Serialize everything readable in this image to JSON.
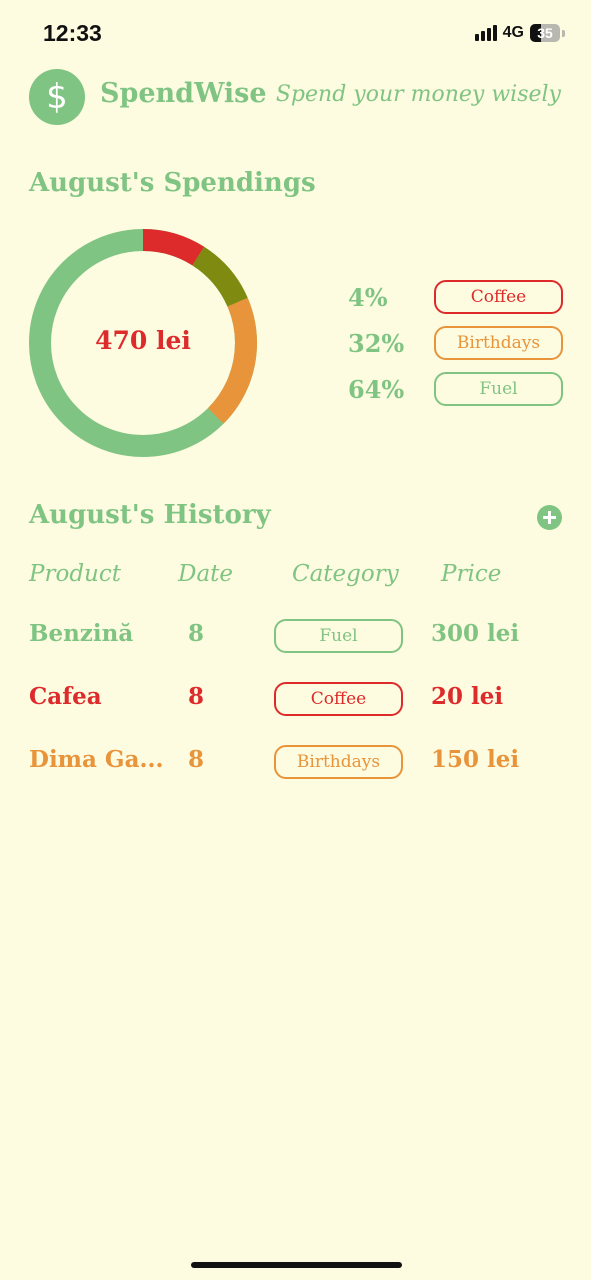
{
  "status_bar": {
    "time": "12:33",
    "network": "4G",
    "battery": "35",
    "battery_level": 0.35
  },
  "header": {
    "logo_icon": "dollar-sign-icon",
    "logo_glyph": "$",
    "app_name": "SpendWise",
    "tagline": "Spend your money wisely"
  },
  "spendings": {
    "title": "August's Spendings",
    "total": "470 lei",
    "chart_data": {
      "type": "pie",
      "title": "",
      "slices": [
        {
          "label": "Coffee",
          "percent": 4,
          "color": "#dd2b2b"
        },
        {
          "label": "Birthdays",
          "percent": 32,
          "color": "#e8943a"
        },
        {
          "label": "Fuel",
          "percent": 64,
          "color": "#7fc482"
        }
      ],
      "note_colors_in_ring": [
        "#dd2b2b",
        "#7f8a10",
        "#e8943a",
        "#7fc482"
      ]
    },
    "legend": [
      {
        "percent": "4%",
        "category": "Coffee",
        "style": "red"
      },
      {
        "percent": "32%",
        "category": "Birthdays",
        "style": "orange"
      },
      {
        "percent": "64%",
        "category": "Fuel",
        "style": "green"
      }
    ]
  },
  "history": {
    "title": "August's History",
    "add_icon": "plus-circle-icon",
    "columns": [
      "Product",
      "Date",
      "Category",
      "Price"
    ],
    "rows": [
      {
        "product": "Benzină",
        "date": "8",
        "category": "Fuel",
        "price": "300 lei",
        "style": "green"
      },
      {
        "product": "Cafea",
        "date": "8",
        "category": "Coffee",
        "price": "20 lei",
        "style": "red"
      },
      {
        "product": "Dima Ga...",
        "date": "8",
        "category": "Birthdays",
        "price": "150 lei",
        "style": "orange"
      }
    ]
  },
  "colors": {
    "background": "#fdfbe0",
    "accent_green": "#7fc482",
    "red": "#dd2b2b",
    "orange": "#e8943a",
    "olive": "#7f8a10"
  }
}
